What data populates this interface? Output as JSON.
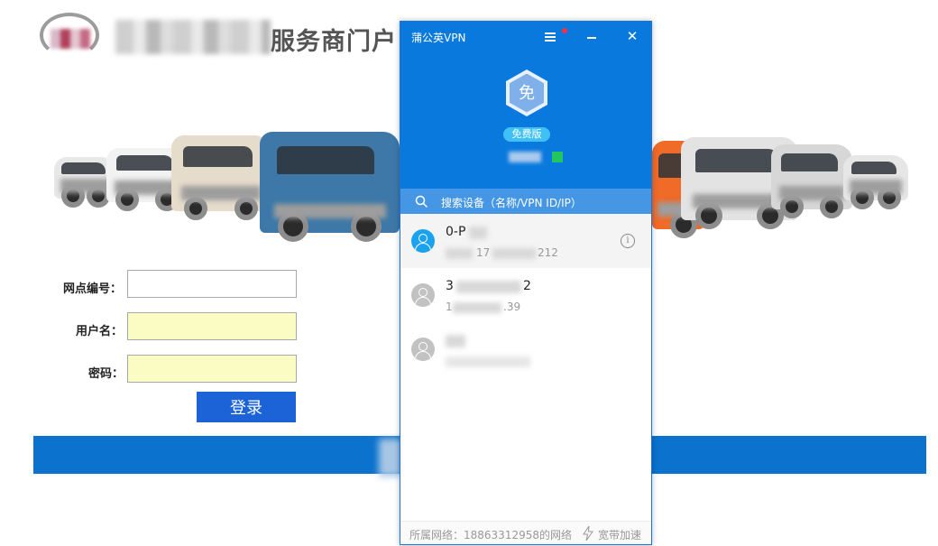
{
  "portal": {
    "title": "服务商门户",
    "fields": [
      {
        "label": "网点编号：",
        "value": ""
      },
      {
        "label": "用户名：",
        "value": ""
      },
      {
        "label": "密码：",
        "value": ""
      }
    ],
    "login_label": "登录"
  },
  "vpn": {
    "title": "蒲公英VPN",
    "badge_glyph": "免",
    "plan_label": "免费版",
    "search": {
      "placeholder": "搜索设备（名称/VPN ID/IP）"
    },
    "devices": [
      {
        "name": "0-P",
        "ip": "17",
        "ip_tail": "212",
        "online": true
      },
      {
        "name": "3",
        "name_tail": "2",
        "ip": "1",
        "ip_tail": ".39",
        "online": false
      },
      {
        "name": "",
        "ip": "",
        "online": false
      }
    ],
    "footer": {
      "network_label": "所属网络：18863312958的网络",
      "boost_label": "宽带加速"
    },
    "icons": {
      "menu": "menu-icon",
      "minimize": "minimize-icon",
      "close": "close-icon",
      "search": "search-icon",
      "info": "info-icon",
      "bolt": "bolt-icon",
      "avatar": "user-avatar-icon"
    },
    "colors": {
      "header": "#0a79de",
      "search_bar": "#4597e5",
      "online_avatar": "#1aa2ee",
      "offline_avatar": "#c2c2c2",
      "notify_dot": "#ff2f3f",
      "status_dot": "#22c55e"
    }
  }
}
